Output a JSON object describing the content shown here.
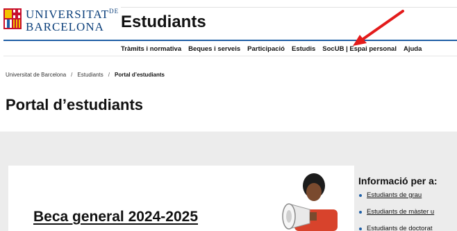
{
  "header": {
    "logo": {
      "line1": "UNIVERSITAT",
      "line1_suffix": "DE",
      "line2": "BARCELONA"
    },
    "site_title": "Estudiants"
  },
  "mainnav": {
    "items": [
      {
        "label": "Tràmits i normativa"
      },
      {
        "label": "Beques i serveis"
      },
      {
        "label": "Participació"
      },
      {
        "label": "Estudis"
      },
      {
        "label": "SocUB | Espai personal"
      },
      {
        "label": "Ajuda"
      }
    ]
  },
  "breadcrumb": {
    "items": [
      "Universitat de Barcelona",
      "Estudiants"
    ],
    "separator": "/",
    "current": "Portal d’estudiants"
  },
  "page": {
    "title": "Portal d’estudiants"
  },
  "featured": {
    "title": "Beca general 2024-2025"
  },
  "info": {
    "title": "Informació per a:",
    "links": [
      "Estudiants de grau",
      "Estudiants de màster u",
      "Estudiants de doctorat"
    ]
  },
  "colors": {
    "brand_blue": "#1f5fa6",
    "logo_blue": "#0a3e7a",
    "arrow_red": "#e31b1b",
    "band_grey": "#ececec"
  }
}
